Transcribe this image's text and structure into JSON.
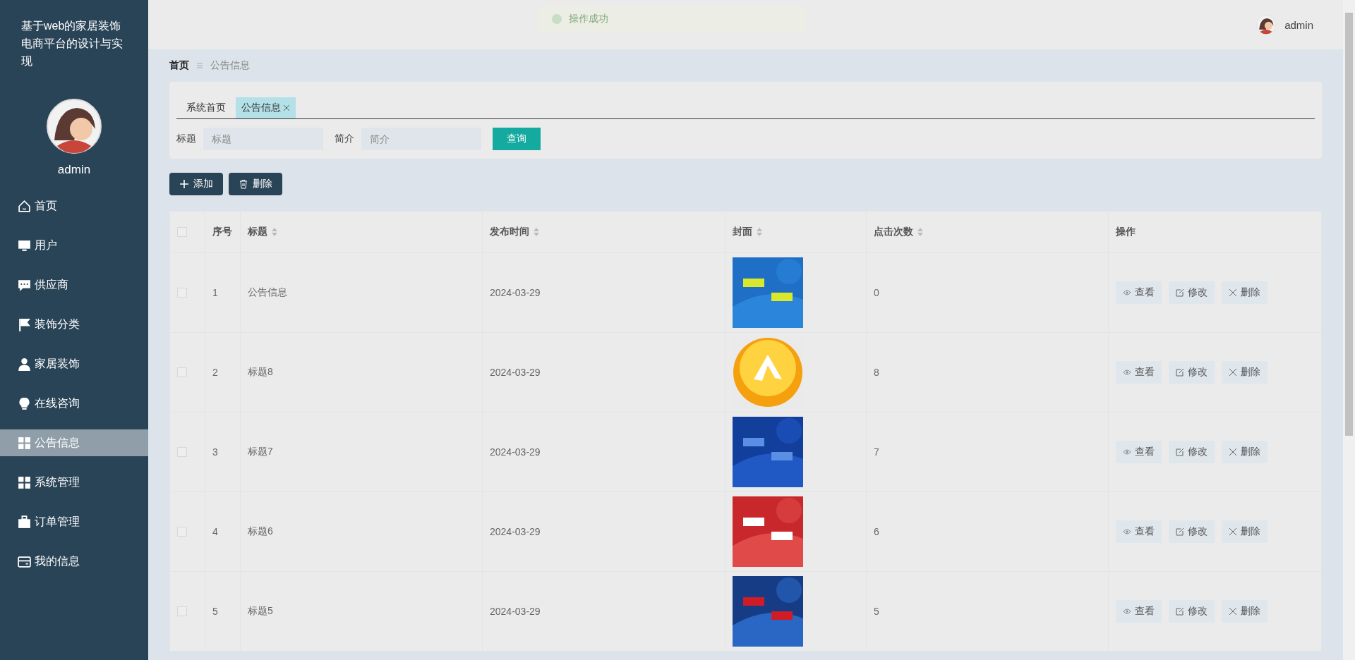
{
  "sidebar": {
    "title": "基于web的家居装饰电商平台的设计与实现",
    "user": "admin",
    "items": [
      {
        "label": "首页",
        "selected": false
      },
      {
        "label": "用户",
        "selected": false
      },
      {
        "label": "供应商",
        "selected": false
      },
      {
        "label": "装饰分类",
        "selected": false
      },
      {
        "label": "家居装饰",
        "selected": false
      },
      {
        "label": "在线咨询",
        "selected": false
      },
      {
        "label": "公告信息",
        "selected": true
      },
      {
        "label": "系统管理",
        "selected": false
      },
      {
        "label": "订单管理",
        "selected": false
      },
      {
        "label": "我的信息",
        "selected": false
      }
    ]
  },
  "toast": "操作成功",
  "header": {
    "user": "admin"
  },
  "breadcrumb": [
    "首页",
    "公告信息"
  ],
  "tabs": [
    {
      "label": "系统首页",
      "selected": false,
      "closable": false
    },
    {
      "label": "公告信息",
      "selected": true,
      "closable": true
    }
  ],
  "search": {
    "fields": [
      {
        "label": "标题",
        "placeholder": "标题"
      },
      {
        "label": "简介",
        "placeholder": "简介"
      }
    ],
    "button": "查询"
  },
  "actions": [
    "添加",
    "删除"
  ],
  "table": {
    "all_checked": false,
    "columns": [
      {
        "label": "序号",
        "sortable": false
      },
      {
        "label": "标题",
        "sortable": true
      },
      {
        "label": "发布时间",
        "sortable": true
      },
      {
        "label": "封面",
        "sortable": true
      },
      {
        "label": "点击次数",
        "sortable": true
      },
      {
        "label": "操作",
        "sortable": false
      }
    ],
    "rows": [
      {
        "checked": false,
        "index": "1",
        "title": "公告信息",
        "date": "2024-03-29",
        "clicks": "0",
        "actions": [
          "查看",
          "修改",
          "删除"
        ]
      },
      {
        "checked": false,
        "index": "2",
        "title": "标题8",
        "date": "2024-03-29",
        "clicks": "8",
        "actions": [
          "查看",
          "修改",
          "删除"
        ]
      },
      {
        "checked": false,
        "index": "3",
        "title": "标题7",
        "date": "2024-03-29",
        "clicks": "7",
        "actions": [
          "查看",
          "修改",
          "删除"
        ]
      },
      {
        "checked": false,
        "index": "4",
        "title": "标题6",
        "date": "2024-03-29",
        "clicks": "6",
        "actions": [
          "查看",
          "修改",
          "删除"
        ]
      },
      {
        "checked": false,
        "index": "5",
        "title": "标题5",
        "date": "2024-03-29",
        "clicks": "5",
        "actions": [
          "查看",
          "修改",
          "删除"
        ]
      }
    ]
  }
}
